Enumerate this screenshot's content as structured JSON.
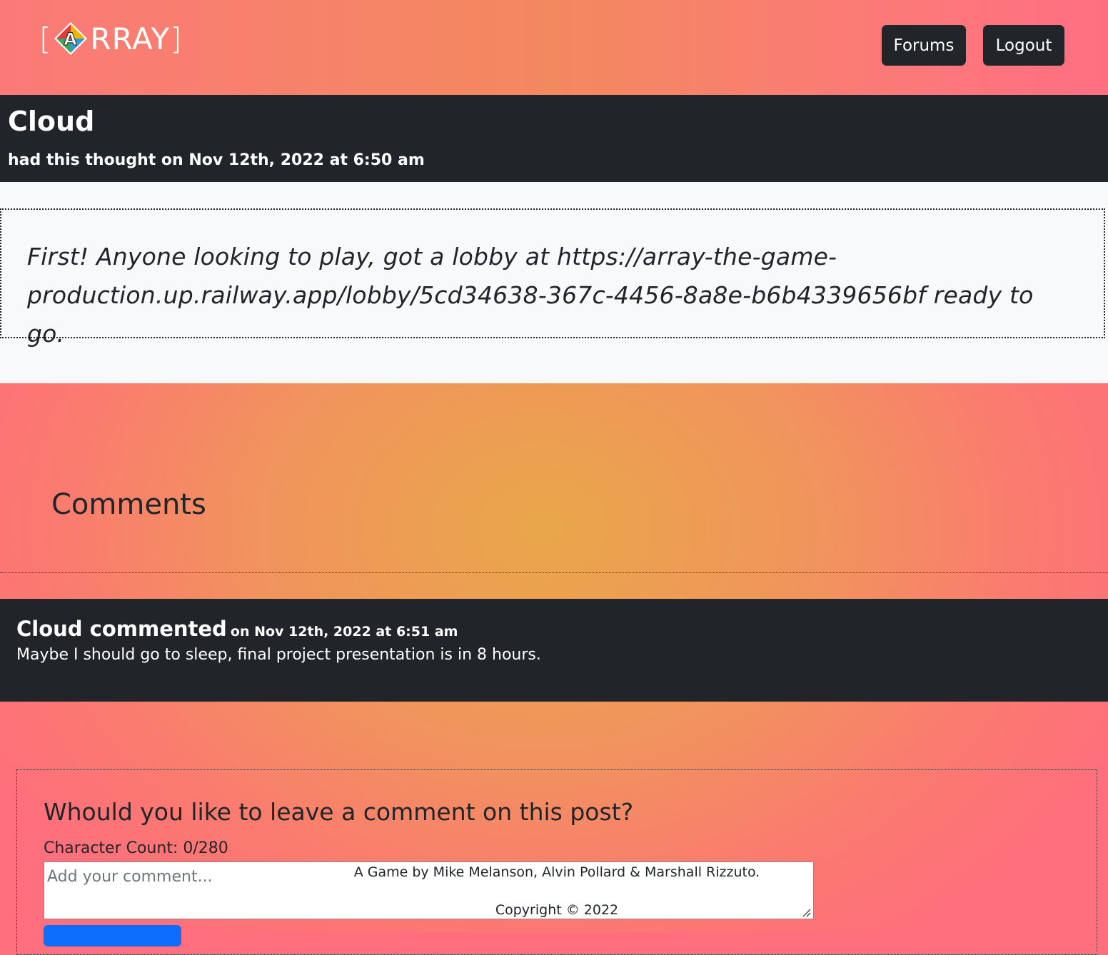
{
  "header": {
    "logo": {
      "left_bracket": "[",
      "letter": "A",
      "text": "RRAY",
      "right_bracket": "]"
    },
    "nav": {
      "forums_label": "Forums",
      "logout_label": "Logout"
    }
  },
  "post": {
    "author": "Cloud",
    "meta": "had this thought on Nov 12th, 2022 at 6:50 am",
    "line1": "First! Anyone looking to play, got a lobby at https://array-the-game-",
    "line2": "production.up.railway.app/lobby/5cd34638-367c-4456-8a8e-b6b4339656bf ready to go."
  },
  "comments": {
    "title": "Comments",
    "items": [
      {
        "author_label": "Cloud commented",
        "date": "on Nov 12th, 2022 at 6:51 am",
        "text": "Maybe I should go to sleep, final project presentation is in 8 hours."
      }
    ]
  },
  "form": {
    "title": "Whould you like to leave a comment on this post?",
    "char_count": "Character Count: 0/280",
    "placeholder": "Add your comment..."
  },
  "footer": {
    "credit": "A Game by Mike Melanson, Alvin Pollard & Marshall Rizzuto.",
    "copyright": "Copyright © 2022"
  },
  "colors": {
    "dark": "#212529",
    "light": "#f8f9fa",
    "primary": "#0d6efd"
  }
}
